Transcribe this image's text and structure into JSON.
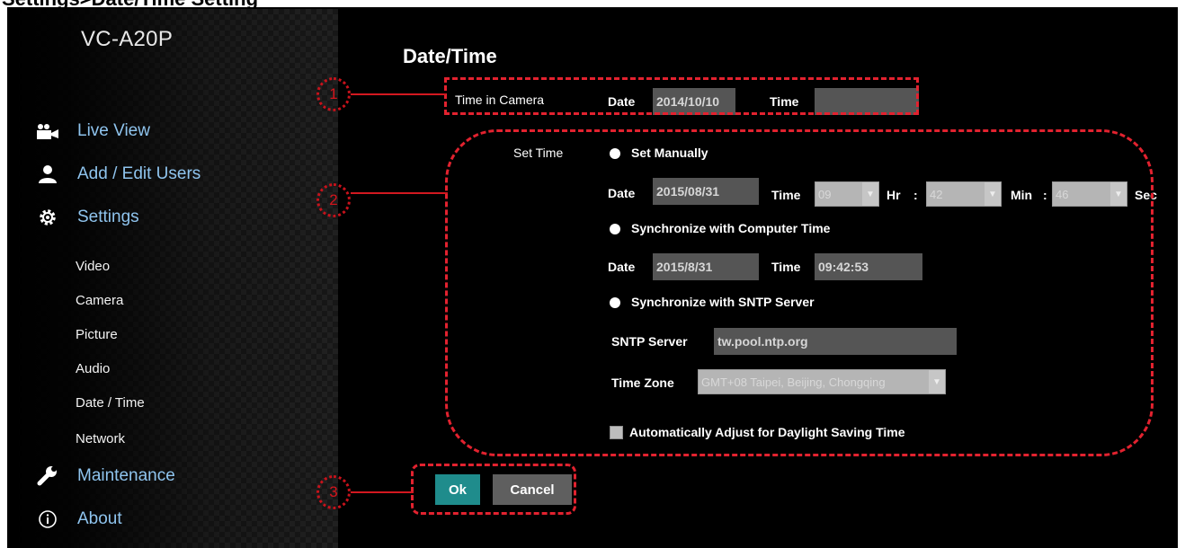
{
  "doc_heading": "Settings>Date/Time Setting",
  "sidebar": {
    "model": "VC-A20P",
    "nav": [
      {
        "label": "Live View",
        "icon": "video-camera-icon"
      },
      {
        "label": "Add / Edit Users",
        "icon": "user-icon"
      },
      {
        "label": "Settings",
        "icon": "gear-icon"
      },
      {
        "label": "Maintenance",
        "icon": "wrench-icon"
      },
      {
        "label": "About",
        "icon": "info-icon"
      }
    ],
    "settings_items": [
      "Video",
      "Camera",
      "Picture",
      "Audio",
      "Date / Time",
      "Network"
    ]
  },
  "page": {
    "title": "Date/Time",
    "time_in_camera": {
      "label": "Time in Camera",
      "date_label": "Date",
      "date_value": "2014/10/10",
      "time_label": "Time",
      "time_value": ""
    },
    "set_time": {
      "label": "Set Time",
      "manual": {
        "option_label": "Set Manually",
        "date_label": "Date",
        "date_value": "2015/08/31",
        "time_label": "Time",
        "hour": "09",
        "hour_unit": "Hr",
        "separator": ":",
        "minute": "42",
        "minute_unit": "Min",
        "second": "46",
        "second_unit": "Sec"
      },
      "sync_computer": {
        "option_label": "Synchronize with Computer Time",
        "date_label": "Date",
        "date_value": "2015/8/31",
        "time_label": "Time",
        "time_value": "09:42:53"
      },
      "sync_sntp": {
        "option_label": "Synchronize with SNTP Server",
        "server_label": "SNTP Server",
        "server_value": "tw.pool.ntp.org",
        "timezone_label": "Time Zone",
        "timezone_value": "GMT+08 Taipei, Beijing, Chongqing"
      },
      "dst_label": "Automatically Adjust for Daylight Saving Time"
    },
    "ok_label": "Ok",
    "cancel_label": "Cancel"
  },
  "annotations": {
    "callout_1": "1",
    "callout_2": "2",
    "callout_3": "3"
  },
  "colors": {
    "annotation": "#e2222f",
    "nav_text": "#8fc4ee",
    "ok_button": "#1f8c8c",
    "field_bg": "#555555"
  }
}
